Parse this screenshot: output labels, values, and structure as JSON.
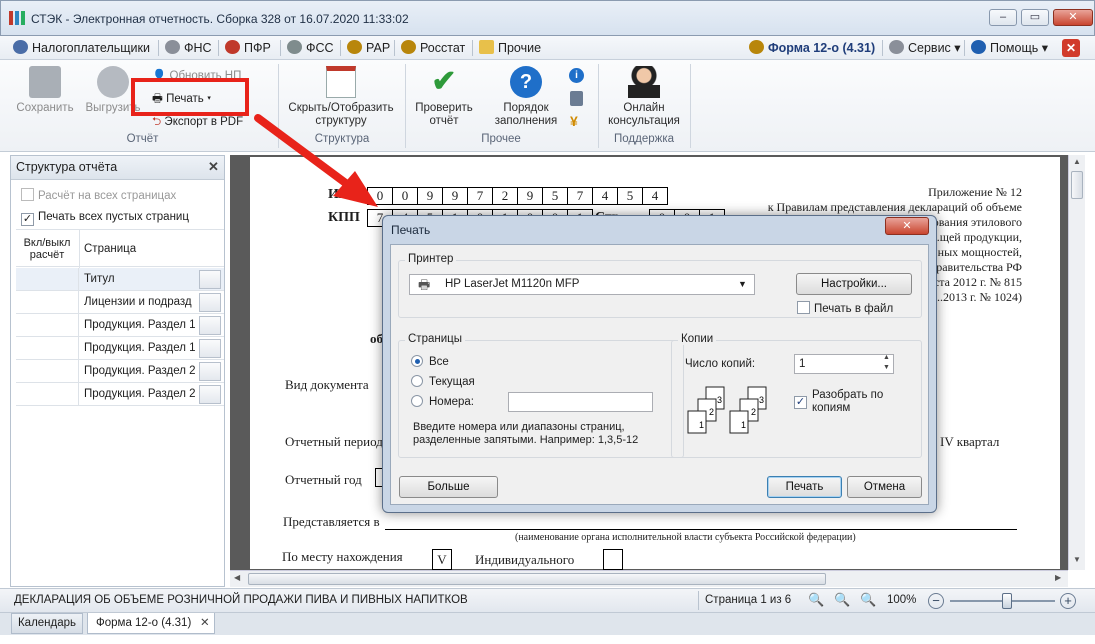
{
  "window": {
    "title": "СТЭК - Электронная отчетность. Сборка 328 от 16.07.2020 11:33:02"
  },
  "menu": {
    "items": [
      {
        "label": "Налогоплательщики",
        "icon": "people-icon",
        "color": "#4a6da7"
      },
      {
        "label": "ФНС",
        "icon": "fns-emblem-icon",
        "color": "#7a7f8a"
      },
      {
        "label": "ПФР",
        "icon": "pfr-icon",
        "color": "#c0392b"
      },
      {
        "label": "ФСС",
        "icon": "fss-icon",
        "color": "#7f8c8d"
      },
      {
        "label": "РАР",
        "icon": "rar-emblem-icon",
        "color": "#b8860b"
      },
      {
        "label": "Росстат",
        "icon": "rosstat-icon",
        "color": "#b8860b"
      },
      {
        "label": "Прочие",
        "icon": "folder-icon",
        "color": "#e8c04a"
      }
    ],
    "form_label": "Форма 12-о (4.31)",
    "service": "Сервис",
    "help": "Помощь"
  },
  "ribbon": {
    "save": "Сохранить",
    "upload": "Выгрузить",
    "check_np": "Обновить НП",
    "print": "Печать",
    "export_pdf": "Экспорт в PDF",
    "group_report": "Отчёт",
    "toggle_structure": "Скрыть/Отобразить структуру",
    "group_structure": "Структура",
    "check_report": "Проверить отчёт",
    "fill_order": "Порядок заполнения",
    "group_other": "Прочее",
    "consult": "Онлайн консультация",
    "group_support": "Поддержка"
  },
  "structure_panel": {
    "title": "Структура отчёта",
    "calc_all_pages": "Расчёт на всех страницах",
    "print_empty": "Печать всех пустых страниц",
    "col_toggle": "Вкл/выкл расчёт",
    "col_page": "Страница",
    "rows": [
      "Титул",
      "Лицензии и подразд",
      "Продукция. Раздел 1",
      "Продукция. Раздел 1",
      "Продукция. Раздел 2",
      "Продукция. Раздел 2"
    ]
  },
  "document": {
    "inn_label": "ИНН",
    "inn_digits": [
      "0",
      "0",
      "9",
      "9",
      "7",
      "2",
      "9",
      "5",
      "7",
      "4",
      "5",
      "4"
    ],
    "kpp_label": "КПП",
    "kpp_digits": [
      "7",
      "4",
      "5",
      "1",
      "0",
      "1",
      "0",
      "0",
      "1"
    ],
    "page_label": "Стр.",
    "page_digits": [
      "0",
      "0",
      "1"
    ],
    "appendix": [
      "Приложение № 12",
      "к Правилам представления деклараций об объеме",
      "...ования этилового",
      "...щей продукции,",
      "...ных мощностей,",
      "...равительства РФ",
      "...ста 2012 г. № 815",
      "...2013 г. № 1024)"
    ],
    "ob": "об",
    "doc_type": "Вид документа",
    "period": "Отчетный период",
    "quarter": "IV квартал",
    "year": "Отчетный год",
    "presented_to": "Представляется в",
    "authority_caption": "(наименование органа исполнительной власти субъекта Российской федерации)",
    "at_location": "По месту нахождения",
    "v_mark": "V",
    "individual": "Индивидуального"
  },
  "status": {
    "declaration": "ДЕКЛАРАЦИЯ ОБ ОБЪЕМЕ РОЗНИЧНОЙ ПРОДАЖИ ПИВА И ПИВНЫХ НАПИТКОВ",
    "page_info": "Страница 1 из 6",
    "zoom": "100%",
    "zoom_level": 0.55
  },
  "tabs": [
    {
      "label": "Календарь"
    },
    {
      "label": "Форма 12-о (4.31)"
    }
  ],
  "print_dialog": {
    "title": "Печать",
    "printer_group": "Принтер",
    "printer_name": "HP LaserJet M1120n MFP",
    "settings": "Настройки...",
    "print_to_file": "Печать в файл",
    "pages_group": "Страницы",
    "all": "Все",
    "current": "Текущая",
    "numbers": "Номера:",
    "hint": "Введите номера или диапазоны страниц, разделенные запятыми. Например: 1,3,5-12",
    "copies_group": "Копии",
    "copies_label": "Число копий:",
    "copies_value": "1",
    "collate": "Разобрать по копиям",
    "more": "Больше",
    "print": "Печать",
    "cancel": "Отмена"
  },
  "colors": {
    "highlight": "#e8231a",
    "accent": "#1f5fb0"
  }
}
